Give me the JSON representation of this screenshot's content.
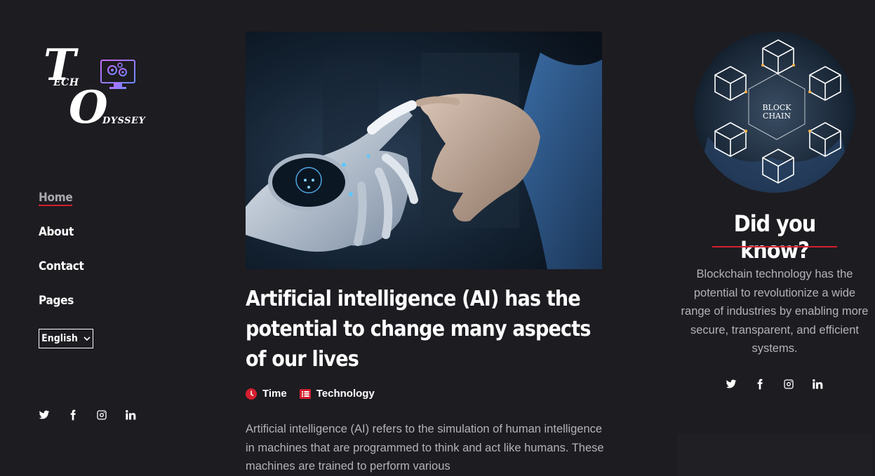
{
  "logo": {
    "letters": {
      "t": "T",
      "ech": "ECH",
      "o": "O",
      "dyssey": "DYSSEY"
    }
  },
  "nav": {
    "items": [
      {
        "label": "Home",
        "active": true
      },
      {
        "label": "About"
      },
      {
        "label": "Contact"
      },
      {
        "label": "Pages"
      }
    ]
  },
  "language": {
    "selected": "English",
    "icon": "chevron-down-icon"
  },
  "social_icons": [
    "twitter-icon",
    "facebook-icon",
    "instagram-icon",
    "linkedin-icon"
  ],
  "article": {
    "title": "Artificial intelligence (AI) has the potential to change many aspects of our lives",
    "meta": [
      {
        "icon": "clock-icon",
        "label": "Time"
      },
      {
        "icon": "list-icon",
        "label": "Technology"
      }
    ],
    "body": "Artificial intelligence (AI) refers to the simulation of human intelligence in machines that are programmed to think and act like humans. These machines are trained to perform various"
  },
  "sidebar_right": {
    "image_text": "BLOCK CHAIN",
    "heading": "Did you know?",
    "fact": "Blockchain technology has the potential to revolutionize a wide range of industries by enabling more secure, transparent, and efficient systems."
  },
  "colors": {
    "background": "#1d1c21",
    "accent": "#d41f2f",
    "muted_text": "#b3b2b8"
  }
}
